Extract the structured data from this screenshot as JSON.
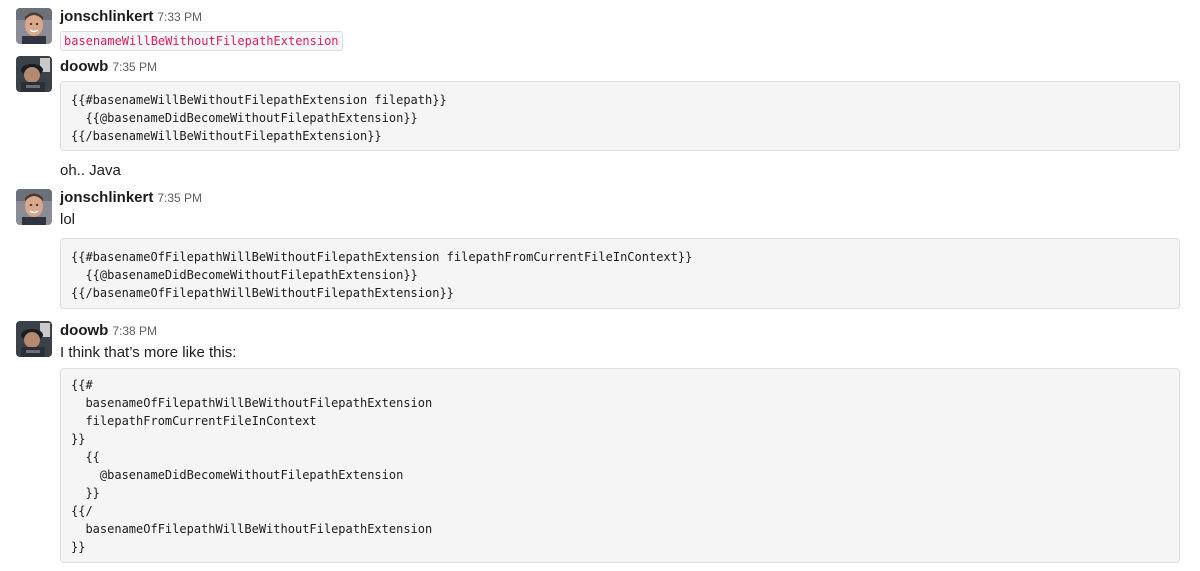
{
  "messages": [
    {
      "author": "jonschlinkert",
      "time": "7:33 PM",
      "inline_code": "basenameWillBeWithoutFilepathExtension"
    },
    {
      "author": "doowb",
      "time": "7:35 PM",
      "code_lines": [
        "{{#basenameWillBeWithoutFilepathExtension filepath}}",
        "  {{@basenameDidBecomeWithoutFilepathExtension}}",
        "{{/basenameWillBeWithoutFilepathExtension}}"
      ],
      "text_after": "oh.. Java"
    },
    {
      "author": "jonschlinkert",
      "time": "7:35 PM",
      "text": "lol",
      "code_lines": [
        "{{#basenameOfFilepathWillBeWithoutFilepathExtension filepathFromCurrentFileInContext}}",
        "  {{@basenameDidBecomeWithoutFilepathExtension}}",
        "{{/basenameOfFilepathWillBeWithoutFilepathExtension}}"
      ]
    },
    {
      "author": "doowb",
      "time": "7:38 PM",
      "text": "I think that’s more like this:",
      "code_lines": [
        "{{#",
        "  basenameOfFilepathWillBeWithoutFilepathExtension",
        "  filepathFromCurrentFileInContext",
        "}}",
        "  {{",
        "    @basenameDidBecomeWithoutFilepathExtension",
        "  }}",
        "{{/",
        "  basenameOfFilepathWillBeWithoutFilepathExtension",
        "}}"
      ]
    }
  ],
  "avatars": {
    "jonschlinkert": "avatar-jonschlinkert",
    "doowb": "avatar-doowb"
  },
  "colors": {
    "inline_code_text": "#e01e5a",
    "codeblock_bg": "#f5f5f5",
    "timestamp": "#616061"
  }
}
